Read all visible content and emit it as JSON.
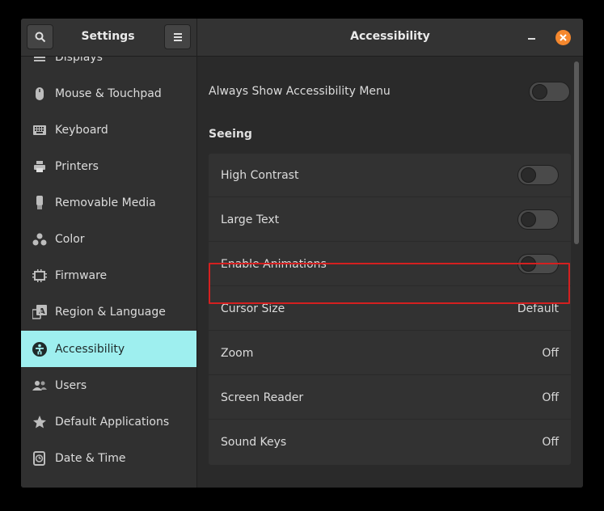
{
  "sidebar_header": {
    "title": "Settings"
  },
  "content_header": {
    "title": "Accessibility"
  },
  "sidebar": {
    "items": [
      {
        "label": "Displays",
        "icon": "display-icon"
      },
      {
        "label": "Mouse & Touchpad",
        "icon": "mouse-icon"
      },
      {
        "label": "Keyboard",
        "icon": "keyboard-icon"
      },
      {
        "label": "Printers",
        "icon": "printer-icon"
      },
      {
        "label": "Removable Media",
        "icon": "usb-drive-icon"
      },
      {
        "label": "Color",
        "icon": "color-icon"
      },
      {
        "label": "Firmware",
        "icon": "chip-icon"
      },
      {
        "label": "Region & Language",
        "icon": "language-icon"
      },
      {
        "label": "Accessibility",
        "icon": "accessibility-icon",
        "active": true
      },
      {
        "label": "Users",
        "icon": "users-icon"
      },
      {
        "label": "Default Applications",
        "icon": "star-icon"
      },
      {
        "label": "Date & Time",
        "icon": "clock-icon"
      }
    ]
  },
  "main": {
    "always_show_menu": {
      "label": "Always Show Accessibility Menu",
      "enabled": false
    },
    "seeing_section": {
      "title": "Seeing",
      "rows": [
        {
          "label": "High Contrast",
          "type": "toggle",
          "enabled": false
        },
        {
          "label": "Large Text",
          "type": "toggle",
          "enabled": false
        },
        {
          "label": "Enable Animations",
          "type": "toggle",
          "enabled": false,
          "highlighted": true
        },
        {
          "label": "Cursor Size",
          "type": "value",
          "value": "Default"
        },
        {
          "label": "Zoom",
          "type": "value",
          "value": "Off"
        },
        {
          "label": "Screen Reader",
          "type": "value",
          "value": "Off"
        },
        {
          "label": "Sound Keys",
          "type": "value",
          "value": "Off"
        }
      ]
    }
  },
  "colors": {
    "active_item": "#9eefef",
    "close_button": "#f5882e",
    "highlight_border": "#d42020"
  }
}
